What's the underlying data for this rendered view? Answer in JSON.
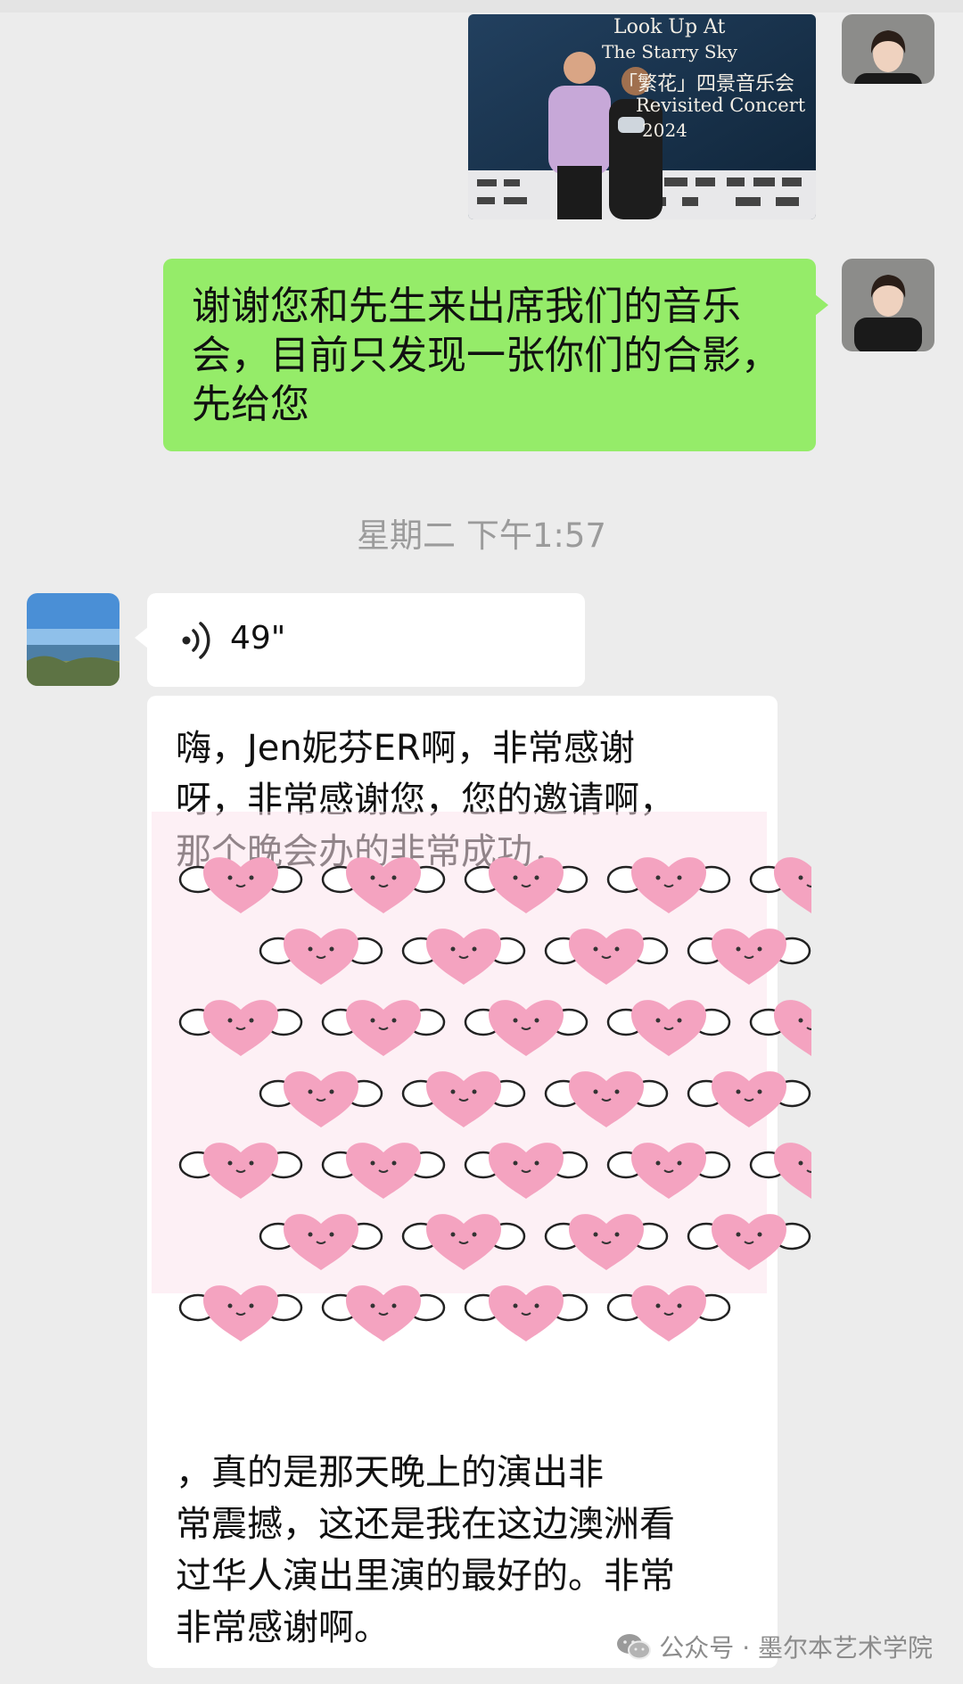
{
  "chat": {
    "photo_message": {
      "poster_lines": [
        "Look Up At",
        "The Starry Sky",
        "「繁花」四景音乐会",
        "Revisited Concert",
        "2024"
      ]
    },
    "outgoing_text": [
      "谢谢您和先生来出席我们的音乐",
      "会，目前只发现一张你们的合影，",
      "先给您"
    ],
    "time_label": "星期二 下午1:57",
    "voice_message": {
      "duration": "49\""
    },
    "transcript_top": [
      "嗨，Jen妮芬ER啊，非常感谢",
      "呀，非常感谢您，您的邀请啊，",
      "那个晚会办的非常成功，"
    ],
    "transcript_bottom": [
      "，真的是那天晚上的演出非",
      "常震撼，这还是我在这边澳洲看",
      "过华人演出里演的最好的。非常",
      "非常感谢啊。"
    ]
  },
  "watermark": {
    "label": "公众号 · 墨尔本艺术学院",
    "icon": "wechat-icon"
  },
  "colors": {
    "background": "#ececec",
    "outgoing_bubble": "#95ec69",
    "incoming_bubble": "#ffffff",
    "sticker_pink": "#f4a3c0"
  }
}
